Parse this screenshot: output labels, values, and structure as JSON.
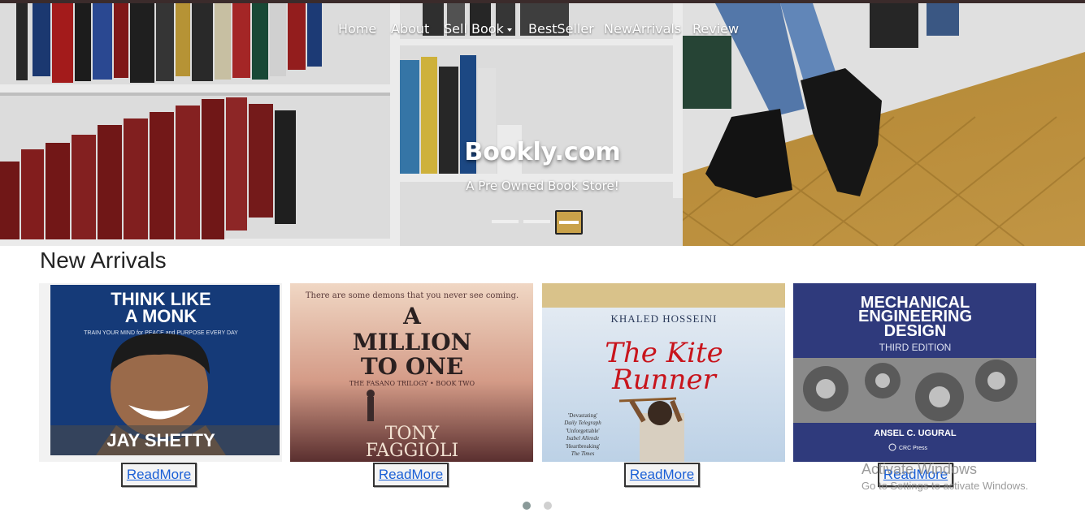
{
  "nav": {
    "items": [
      {
        "label": "Home"
      },
      {
        "label": "About"
      },
      {
        "label": "Sell Book",
        "dropdown": true
      },
      {
        "label": "BestSeller"
      },
      {
        "label": "NewArrivals"
      },
      {
        "label": "Review"
      }
    ]
  },
  "hero": {
    "title": "Bookly.com",
    "subtitle": "A Pre Owned Book Store!",
    "slide_count": 3,
    "active_slide": 3
  },
  "section": {
    "title": "New Arrivals"
  },
  "books": [
    {
      "cover_lines": [
        "THINK LIKE",
        "A MONK"
      ],
      "cover_tagline": "TRAIN YOUR MIND for PEACE and PURPOSE EVERY DAY",
      "author": "JAY SHETTY",
      "button": "ReadMore"
    },
    {
      "cover_top": "There are some demons that you never see coming.",
      "cover_lines": [
        "A",
        "MILLION",
        "TO ONE"
      ],
      "cover_tagline": "THE FASANO TRILOGY • BOOK TWO",
      "author": [
        "TONY",
        "FAGGIOLI"
      ],
      "button": "ReadMore"
    },
    {
      "author": "KHALED HOSSEINI",
      "cover_lines": [
        "The Kite",
        "Runner"
      ],
      "quotes": [
        "'Devastating'",
        "Daily Telegraph",
        "'Unforgettable'",
        "Isabel Allende",
        "'Heartbreaking'",
        "The Times"
      ],
      "button": "ReadMore"
    },
    {
      "cover_lines": [
        "MECHANICAL",
        "ENGINEERING",
        "DESIGN"
      ],
      "edition": "THIRD EDITION",
      "author": "ANSEL C. UGURAL",
      "publisher": "CRC Press",
      "button": "ReadMore"
    }
  ],
  "watermark": {
    "title": "Activate Windows",
    "subtitle": "Go to Settings to activate Windows."
  },
  "pagination": {
    "dots": 2,
    "active": 1
  },
  "colors": {
    "link": "#1a5fd6",
    "hero_text": "#ffffff",
    "monk_cover": "#153a78",
    "mech_cover": "#2f3a7c"
  }
}
